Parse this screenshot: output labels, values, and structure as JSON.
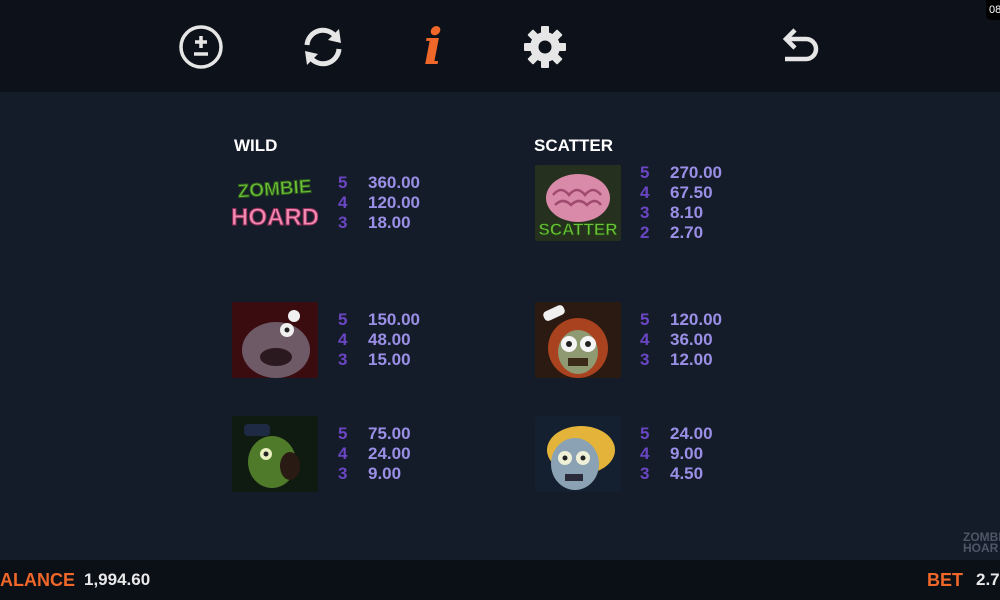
{
  "toolbar": {
    "bet_icon": "plus-minus-icon",
    "autoplay_icon": "refresh-icon",
    "info_icon": "info-icon",
    "settings_icon": "gear-icon",
    "back_icon": "back-arrow-icon",
    "info_glyph": "i",
    "clock": "08"
  },
  "paytable": {
    "wild": {
      "title": "WILD",
      "logo_text_top": "ZOMBIE",
      "logo_text_bottom": "HOARD",
      "pays": [
        {
          "count": "5",
          "value": "360.00"
        },
        {
          "count": "4",
          "value": "120.00"
        },
        {
          "count": "3",
          "value": "18.00"
        }
      ]
    },
    "scatter": {
      "title": "SCATTER",
      "symbol_text": "SCATTER",
      "pays": [
        {
          "count": "5",
          "value": "270.00"
        },
        {
          "count": "4",
          "value": "67.50"
        },
        {
          "count": "3",
          "value": "8.10"
        },
        {
          "count": "2",
          "value": "2.70"
        }
      ]
    },
    "symbols": [
      {
        "pays": [
          {
            "count": "5",
            "value": "150.00"
          },
          {
            "count": "4",
            "value": "48.00"
          },
          {
            "count": "3",
            "value": "15.00"
          }
        ]
      },
      {
        "pays": [
          {
            "count": "5",
            "value": "120.00"
          },
          {
            "count": "4",
            "value": "36.00"
          },
          {
            "count": "3",
            "value": "12.00"
          }
        ]
      },
      {
        "pays": [
          {
            "count": "5",
            "value": "75.00"
          },
          {
            "count": "4",
            "value": "24.00"
          },
          {
            "count": "3",
            "value": "9.00"
          }
        ]
      },
      {
        "pays": [
          {
            "count": "5",
            "value": "24.00"
          },
          {
            "count": "4",
            "value": "9.00"
          },
          {
            "count": "3",
            "value": "4.50"
          }
        ]
      }
    ]
  },
  "footer": {
    "balance_label": "ALANCE",
    "balance_value": "1,994.60",
    "bet_label": "BET",
    "bet_value": "2.7",
    "logo_top": "ZOMBI",
    "logo_bottom": "HOAR"
  },
  "colors": {
    "accent": "#f0672a",
    "pay_count": "#6a46c4",
    "pay_value": "#9a8fe6",
    "background": "#151c29"
  }
}
